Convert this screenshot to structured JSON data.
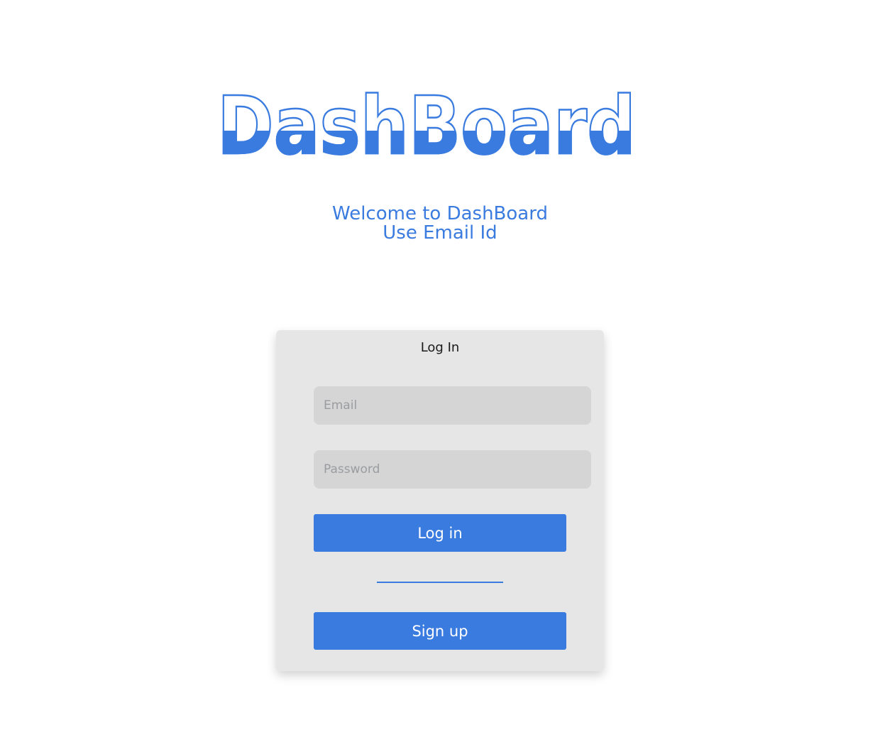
{
  "logo": {
    "text": "DashBoard"
  },
  "welcome": {
    "line1": "Welcome to DashBoard",
    "line2": "Use Email Id"
  },
  "login_card": {
    "title": "Log In",
    "email_placeholder": "Email",
    "password_placeholder": "Password",
    "login_label": "Log in",
    "signup_label": "Sign up"
  },
  "colors": {
    "accent": "#3a7be0",
    "card_background": "#e6e6e6",
    "input_background": "#d5d5d5",
    "page_background": "#ffffff"
  }
}
